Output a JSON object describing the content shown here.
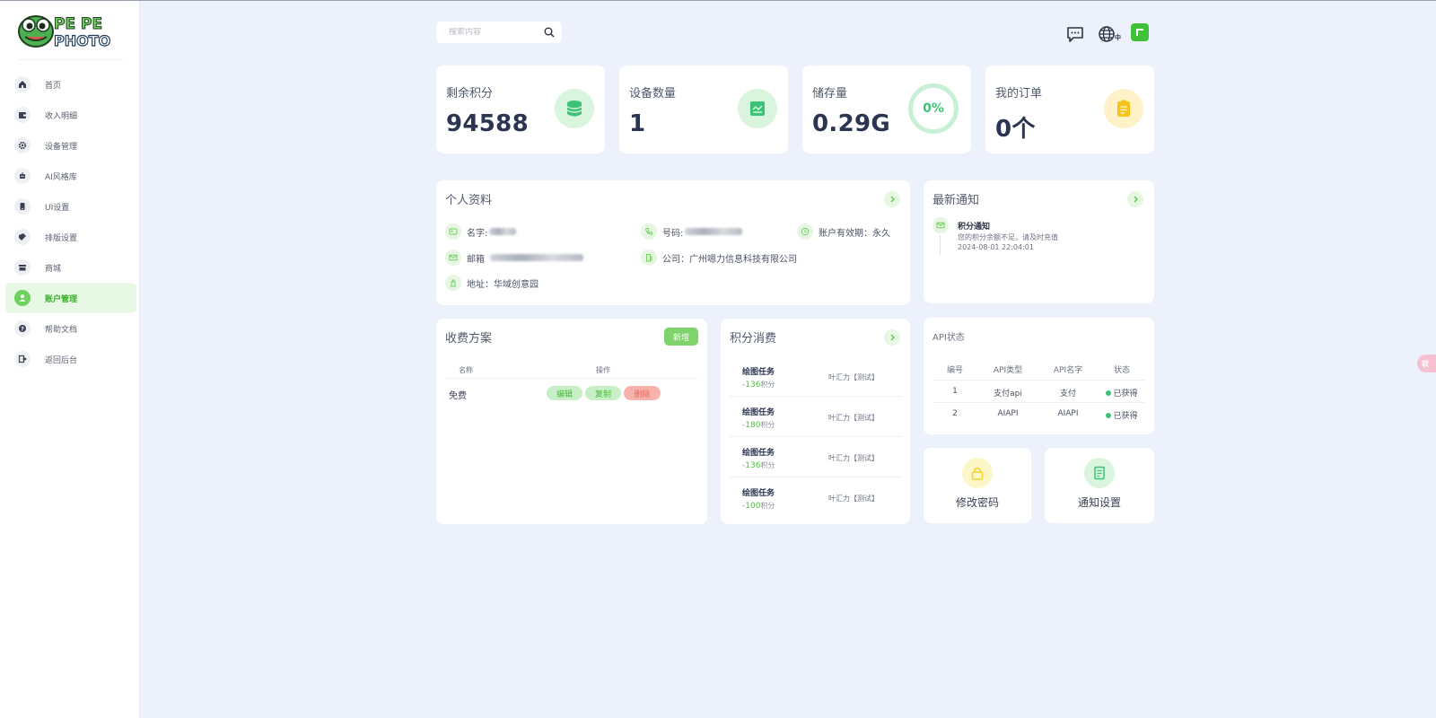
{
  "brand": {
    "logo_line1": "PE PE",
    "logo_line2": "PHOTO"
  },
  "sidebar": {
    "items": [
      {
        "label": "首页",
        "icon": "home-icon"
      },
      {
        "label": "收入明细",
        "icon": "wallet-icon"
      },
      {
        "label": "设备管理",
        "icon": "gear-icon"
      },
      {
        "label": "AI风格库",
        "icon": "ai-style-icon"
      },
      {
        "label": "UI设置",
        "icon": "phone-icon"
      },
      {
        "label": "排版设置",
        "icon": "layout-icon"
      },
      {
        "label": "商城",
        "icon": "store-icon"
      },
      {
        "label": "账户管理",
        "icon": "user-icon",
        "active": true
      },
      {
        "label": "帮助文档",
        "icon": "help-icon"
      },
      {
        "label": "返回后台",
        "icon": "exit-icon"
      }
    ]
  },
  "header": {
    "search_placeholder": "搜索内容",
    "lang_label": "中"
  },
  "stats": {
    "points": {
      "label": "剩余积分",
      "value": "94588"
    },
    "devices": {
      "label": "设备数量",
      "value": "1"
    },
    "storage": {
      "label": "储存量",
      "value": "0.29G",
      "percent": "0%"
    },
    "orders": {
      "label": "我的订单",
      "value": "0个"
    }
  },
  "profile": {
    "title": "个人资料",
    "name_label": "名字:",
    "phone_label": "号码:",
    "validity": "账户有效期：永久",
    "email_label": "邮箱",
    "company": "公司：广州嗯力信息科技有限公司",
    "address": "地址：华域创意园"
  },
  "notice": {
    "title": "最新通知",
    "item_title": "积分通知",
    "item_text": "您的积分余额不足，请及时充值",
    "item_time": "2024-08-01 22:04:01"
  },
  "fee_plan": {
    "title": "收费方案",
    "add_label": "新增",
    "col_name": "名称",
    "col_action": "操作",
    "rows": [
      {
        "name": "免费"
      }
    ],
    "edit_label": "编辑",
    "copy_label": "复制",
    "delete_label": "删除"
  },
  "points_usage": {
    "title": "积分消费",
    "unit": "积分",
    "items": [
      {
        "name": "绘图任务",
        "value": "-136",
        "user": "叶汇力【测试】"
      },
      {
        "name": "绘图任务",
        "value": "-180",
        "user": "叶汇力【测试】"
      },
      {
        "name": "绘图任务",
        "value": "-136",
        "user": "叶汇力【测试】"
      },
      {
        "name": "绘图任务",
        "value": "-100",
        "user": "叶汇力【测试】"
      }
    ]
  },
  "api_status": {
    "title": "API状态",
    "headers": [
      "编号",
      "API类型",
      "API名字",
      "状态"
    ],
    "rows": [
      {
        "id": "1",
        "type": "支付api",
        "name": "支付",
        "status": "已获得"
      },
      {
        "id": "2",
        "type": "AIAPI",
        "name": "AIAPI",
        "status": "已获得"
      }
    ]
  },
  "quick_actions": {
    "change_password": "修改密码",
    "notify_settings": "通知设置"
  },
  "float_tab": "软",
  "colors": {
    "accent_green": "#6fd15e",
    "background": "#edf1fb",
    "delete_red": "#f4a6a0",
    "status_green": "#3cc277"
  }
}
